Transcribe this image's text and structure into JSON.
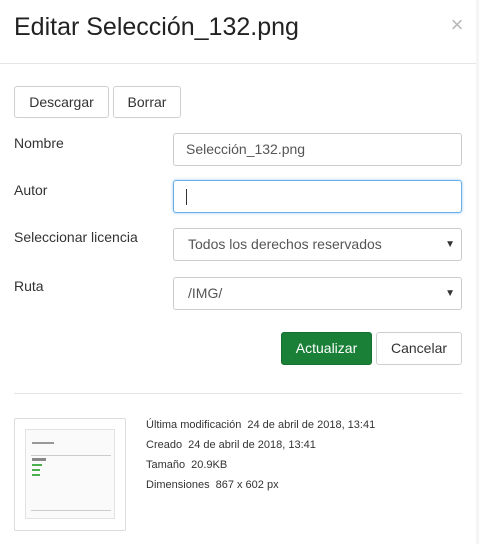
{
  "dialog": {
    "title": "Editar Selección_132.png",
    "close_symbol": "×"
  },
  "toolbar": {
    "download_label": "Descargar",
    "delete_label": "Borrar"
  },
  "form": {
    "name_label": "Nombre",
    "name_value": "Selección_132.png",
    "author_label": "Autor",
    "author_value": "",
    "license_label": "Seleccionar licencia",
    "license_value": "Todos los derechos reservados",
    "path_label": "Ruta",
    "path_value": "/IMG/"
  },
  "actions": {
    "update_label": "Actualizar",
    "cancel_label": "Cancelar"
  },
  "info": {
    "modified_label": "Última modificación",
    "modified_value": "24 de abril de 2018, 13:41",
    "created_label": "Creado",
    "created_value": "24 de abril de 2018, 13:41",
    "size_label": "Tamaño",
    "size_value": "20.9KB",
    "dimensions_label": "Dimensiones",
    "dimensions_value": "867 x 602 px"
  },
  "colors": {
    "primary_button": "#1a7f37",
    "focus_border": "#66afe9"
  },
  "icons": {
    "close": "close-icon",
    "select_arrow": "chevron-down-icon"
  }
}
